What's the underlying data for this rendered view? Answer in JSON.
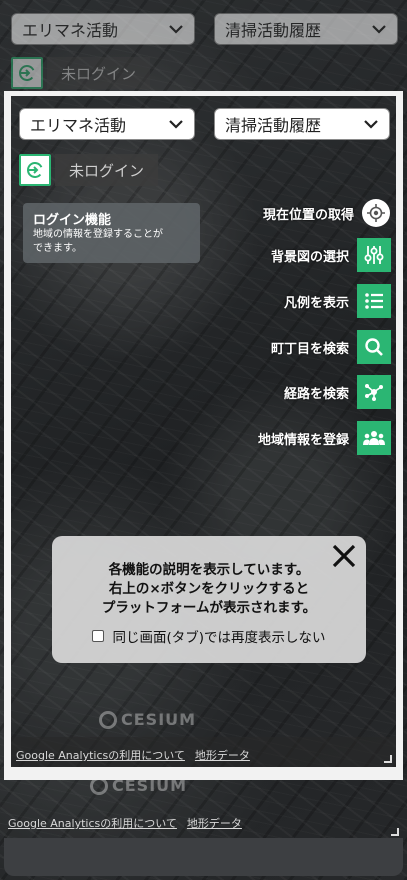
{
  "selects": {
    "activity": "エリマネ活動",
    "history": "清掃活動履歴"
  },
  "login": {
    "label": "未ログイン"
  },
  "tooltip": {
    "title": "ログイン機能",
    "body_line1": "地域の情報を登録することが",
    "body_line2": "できます。"
  },
  "tools": [
    {
      "label": "現在位置の取得",
      "icon": "locate-icon"
    },
    {
      "label": "背景図の選択",
      "icon": "sliders-icon"
    },
    {
      "label": "凡例を表示",
      "icon": "list-icon"
    },
    {
      "label": "町丁目を検索",
      "icon": "search-icon"
    },
    {
      "label": "経路を検索",
      "icon": "route-icon"
    },
    {
      "label": "地域情報を登録",
      "icon": "group-icon"
    }
  ],
  "modal": {
    "line1": "各機能の説明を表示しています。",
    "line2": "右上の×ボタンをクリックすると",
    "line3": "プラットフォームが表示されます。",
    "checkbox_label": "同じ画面(タブ)では再度表示しない"
  },
  "footer": {
    "analytics_link": "Google Analyticsの利用について",
    "terrain_link": "地形データ"
  },
  "cesium_logo": "CESIUM",
  "colors": {
    "accent": "#2bb673"
  }
}
